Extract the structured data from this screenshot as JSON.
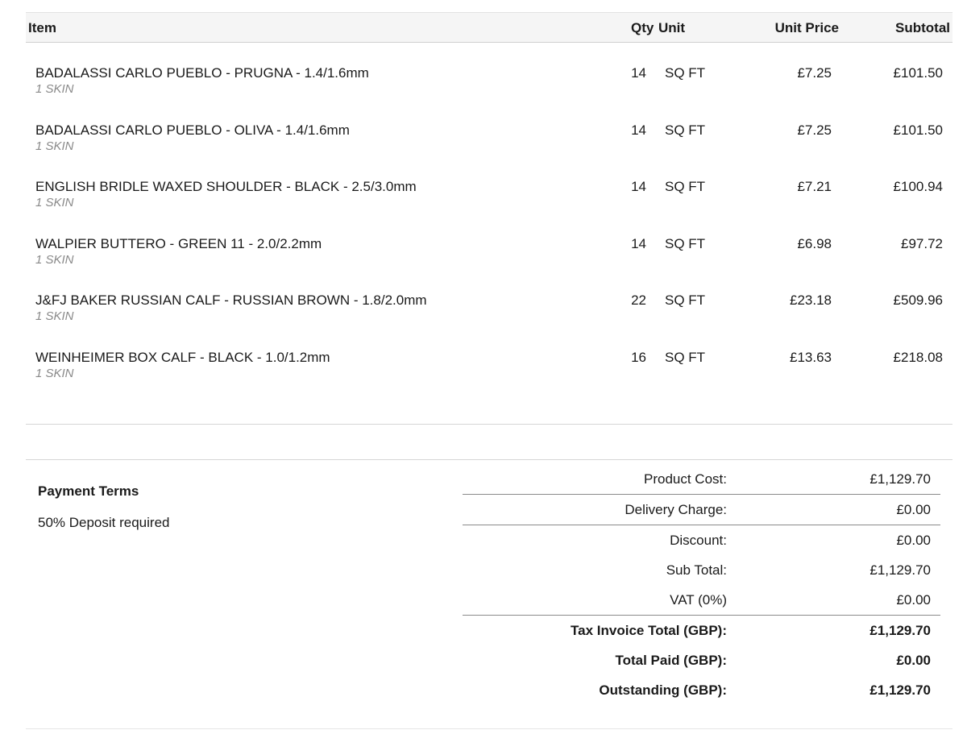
{
  "table": {
    "headers": {
      "item": "Item",
      "qty": "Qty",
      "unit": "Unit",
      "unit_price": "Unit Price",
      "subtotal": "Subtotal"
    },
    "rows": [
      {
        "name": "BADALASSI CARLO PUEBLO - PRUGNA - 1.4/1.6mm",
        "note": "1 SKIN",
        "qty": "14",
        "unit": "SQ FT",
        "unit_price": "£7.25",
        "subtotal": "£101.50"
      },
      {
        "name": "BADALASSI CARLO PUEBLO - OLIVA - 1.4/1.6mm",
        "note": "1 SKIN",
        "qty": "14",
        "unit": "SQ FT",
        "unit_price": "£7.25",
        "subtotal": "£101.50"
      },
      {
        "name": "ENGLISH BRIDLE WAXED SHOULDER - BLACK - 2.5/3.0mm",
        "note": "1 SKIN",
        "qty": "14",
        "unit": "SQ FT",
        "unit_price": "£7.21",
        "subtotal": "£100.94"
      },
      {
        "name": "WALPIER BUTTERO - GREEN 11 - 2.0/2.2mm",
        "note": "1 SKIN",
        "qty": "14",
        "unit": "SQ FT",
        "unit_price": "£6.98",
        "subtotal": "£97.72"
      },
      {
        "name": "J&FJ BAKER RUSSIAN CALF - RUSSIAN BROWN - 1.8/2.0mm",
        "note": "1 SKIN",
        "qty": "22",
        "unit": "SQ FT",
        "unit_price": "£23.18",
        "subtotal": "£509.96"
      },
      {
        "name": "WEINHEIMER BOX CALF - BLACK - 1.0/1.2mm",
        "note": "1 SKIN",
        "qty": "16",
        "unit": "SQ FT",
        "unit_price": "£13.63",
        "subtotal": "£218.08"
      }
    ]
  },
  "payment_terms": {
    "title": "Payment Terms",
    "text": "50% Deposit required"
  },
  "totals": [
    {
      "label": "Product Cost:",
      "value": "£1,129.70",
      "bold": false
    },
    {
      "label": "Delivery Charge:",
      "value": "£0.00",
      "bold": false
    },
    {
      "label": "Discount:",
      "value": "£0.00",
      "bold": false
    },
    {
      "label": "Sub Total:",
      "value": "£1,129.70",
      "bold": false
    },
    {
      "label": "VAT (0%)",
      "value": "£0.00",
      "bold": false
    },
    {
      "label": "Tax Invoice Total (GBP):",
      "value": "£1,129.70",
      "bold": true
    },
    {
      "label": "Total Paid (GBP):",
      "value": "£0.00",
      "bold": true
    },
    {
      "label": "Outstanding (GBP):",
      "value": "£1,129.70",
      "bold": true
    }
  ]
}
